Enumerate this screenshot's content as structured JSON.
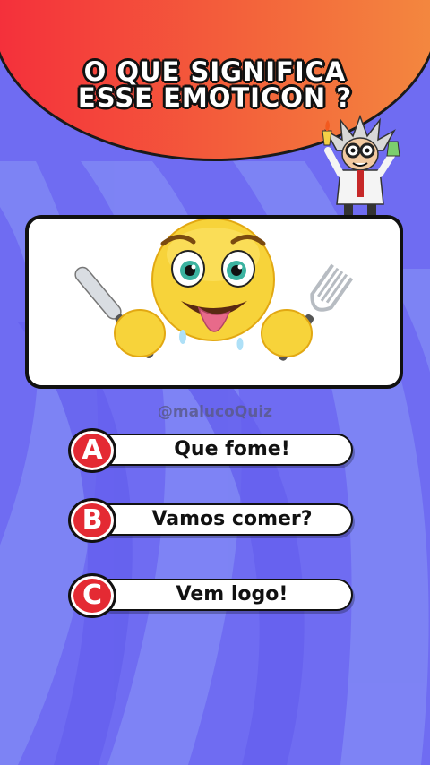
{
  "quiz": {
    "question_line1": "O QUE SIGNIFICA",
    "question_line2": "ESSE EMOTICON ?",
    "watermark": "@malucoQuiz",
    "options": [
      {
        "letter": "A",
        "label": "Que fome!"
      },
      {
        "letter": "B",
        "label": "Vamos comer?"
      },
      {
        "letter": "C",
        "label": "Vem logo!"
      }
    ]
  },
  "colors": {
    "background": "#6f6cf2",
    "header_gradient_start": "#f42f3b",
    "header_gradient_end": "#f3883f",
    "badge": "#e42a33"
  },
  "icons": {
    "emoji": "hungry-face-with-fork-and-knife-icon",
    "mascot": "mad-scientist-mascot-icon"
  }
}
